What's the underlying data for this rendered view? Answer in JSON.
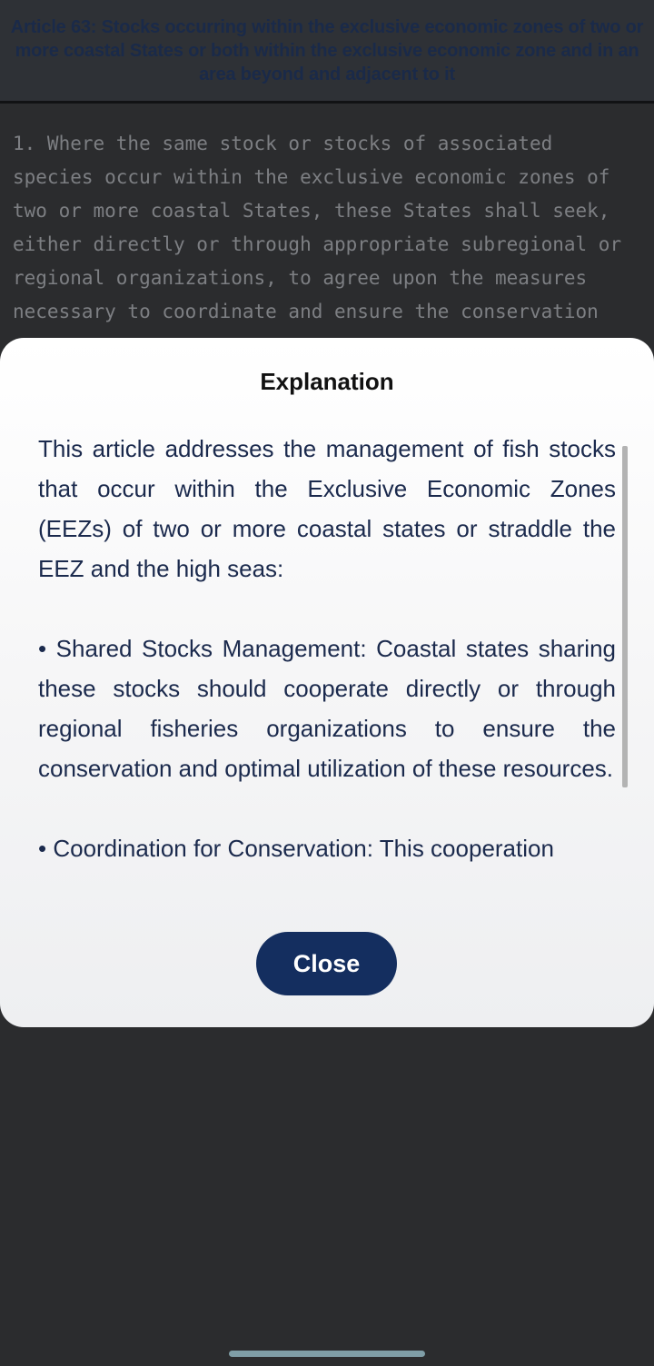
{
  "article": {
    "title": "Article 63: Stocks occurring within the exclusive economic zones of two or more coastal States or both within the exclusive economic zone and in an area beyond and adjacent to it",
    "text": "1. Where the same stock or stocks of associated\nspecies occur within the exclusive economic zones of\ntwo or more coastal States, these States shall seek,\neither directly or through appropriate subregional or\nregional organizations, to agree upon the measures\nnecessary to coordinate and ensure the conservation"
  },
  "dialog": {
    "title": "Explanation",
    "paragraphs": [
      "This article addresses the management of fish stocks that occur within the Exclusive Economic Zones (EEZs) of two or more coastal states or straddle the EEZ and the high seas:",
      "• Shared Stocks Management: Coastal states sharing these stocks should cooperate directly or through regional fisheries organizations to ensure the conservation and optimal utilization of these resources.",
      "• Coordination for Conservation: This cooperation"
    ],
    "close_label": "Close"
  }
}
